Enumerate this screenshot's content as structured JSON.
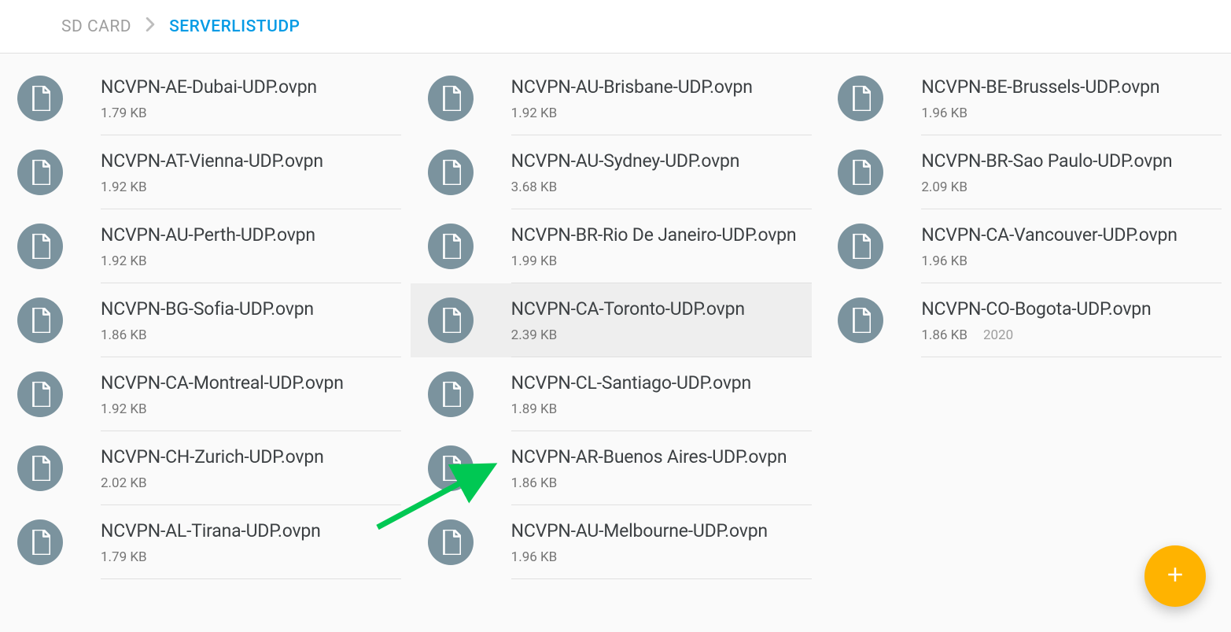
{
  "breadcrumb": {
    "parent": "SD CARD",
    "current": "SERVERLISTUDP"
  },
  "files": [
    {
      "name": "NCVPN-AE-Dubai-UDP.ovpn",
      "size": "1.79 KB",
      "selected": false
    },
    {
      "name": "NCVPN-AT-Vienna-UDP.ovpn",
      "size": "1.92 KB",
      "selected": false
    },
    {
      "name": "NCVPN-AU-Perth-UDP.ovpn",
      "size": "1.92 KB",
      "selected": false
    },
    {
      "name": "NCVPN-BG-Sofia-UDP.ovpn",
      "size": "1.86 KB",
      "selected": false
    },
    {
      "name": "NCVPN-CA-Montreal-UDP.ovpn",
      "size": "1.92 KB",
      "selected": false
    },
    {
      "name": "NCVPN-CH-Zurich-UDP.ovpn",
      "size": "2.02 KB",
      "selected": false
    },
    {
      "name": "NCVPN-AL-Tirana-UDP.ovpn",
      "size": "1.79 KB",
      "selected": false
    },
    {
      "name": "NCVPN-AU-Brisbane-UDP.ovpn",
      "size": "1.92 KB",
      "selected": false
    },
    {
      "name": "NCVPN-AU-Sydney-UDP.ovpn",
      "size": "3.68 KB",
      "selected": false
    },
    {
      "name": "NCVPN-BR-Rio De Janeiro-UDP.ovpn",
      "size": "1.99 KB",
      "selected": false
    },
    {
      "name": "NCVPN-CA-Toronto-UDP.ovpn",
      "size": "2.39 KB",
      "selected": true
    },
    {
      "name": "NCVPN-CL-Santiago-UDP.ovpn",
      "size": "1.89 KB",
      "selected": false
    },
    {
      "name": "NCVPN-AR-Buenos Aires-UDP.ovpn",
      "size": "1.86 KB",
      "selected": false
    },
    {
      "name": "NCVPN-AU-Melbourne-UDP.ovpn",
      "size": "1.96 KB",
      "selected": false
    },
    {
      "name": "NCVPN-BE-Brussels-UDP.ovpn",
      "size": "1.96 KB",
      "selected": false
    },
    {
      "name": "NCVPN-BR-Sao Paulo-UDP.ovpn",
      "size": "2.09 KB",
      "selected": false
    },
    {
      "name": "NCVPN-CA-Vancouver-UDP.ovpn",
      "size": "1.96 KB",
      "selected": false
    },
    {
      "name": "NCVPN-CO-Bogota-UDP.ovpn",
      "size": "1.86 KB",
      "date": "2020",
      "selected": false
    }
  ],
  "icons": {
    "file": "file-icon",
    "add": "plus-icon",
    "chevron": "chevron-right-icon"
  }
}
